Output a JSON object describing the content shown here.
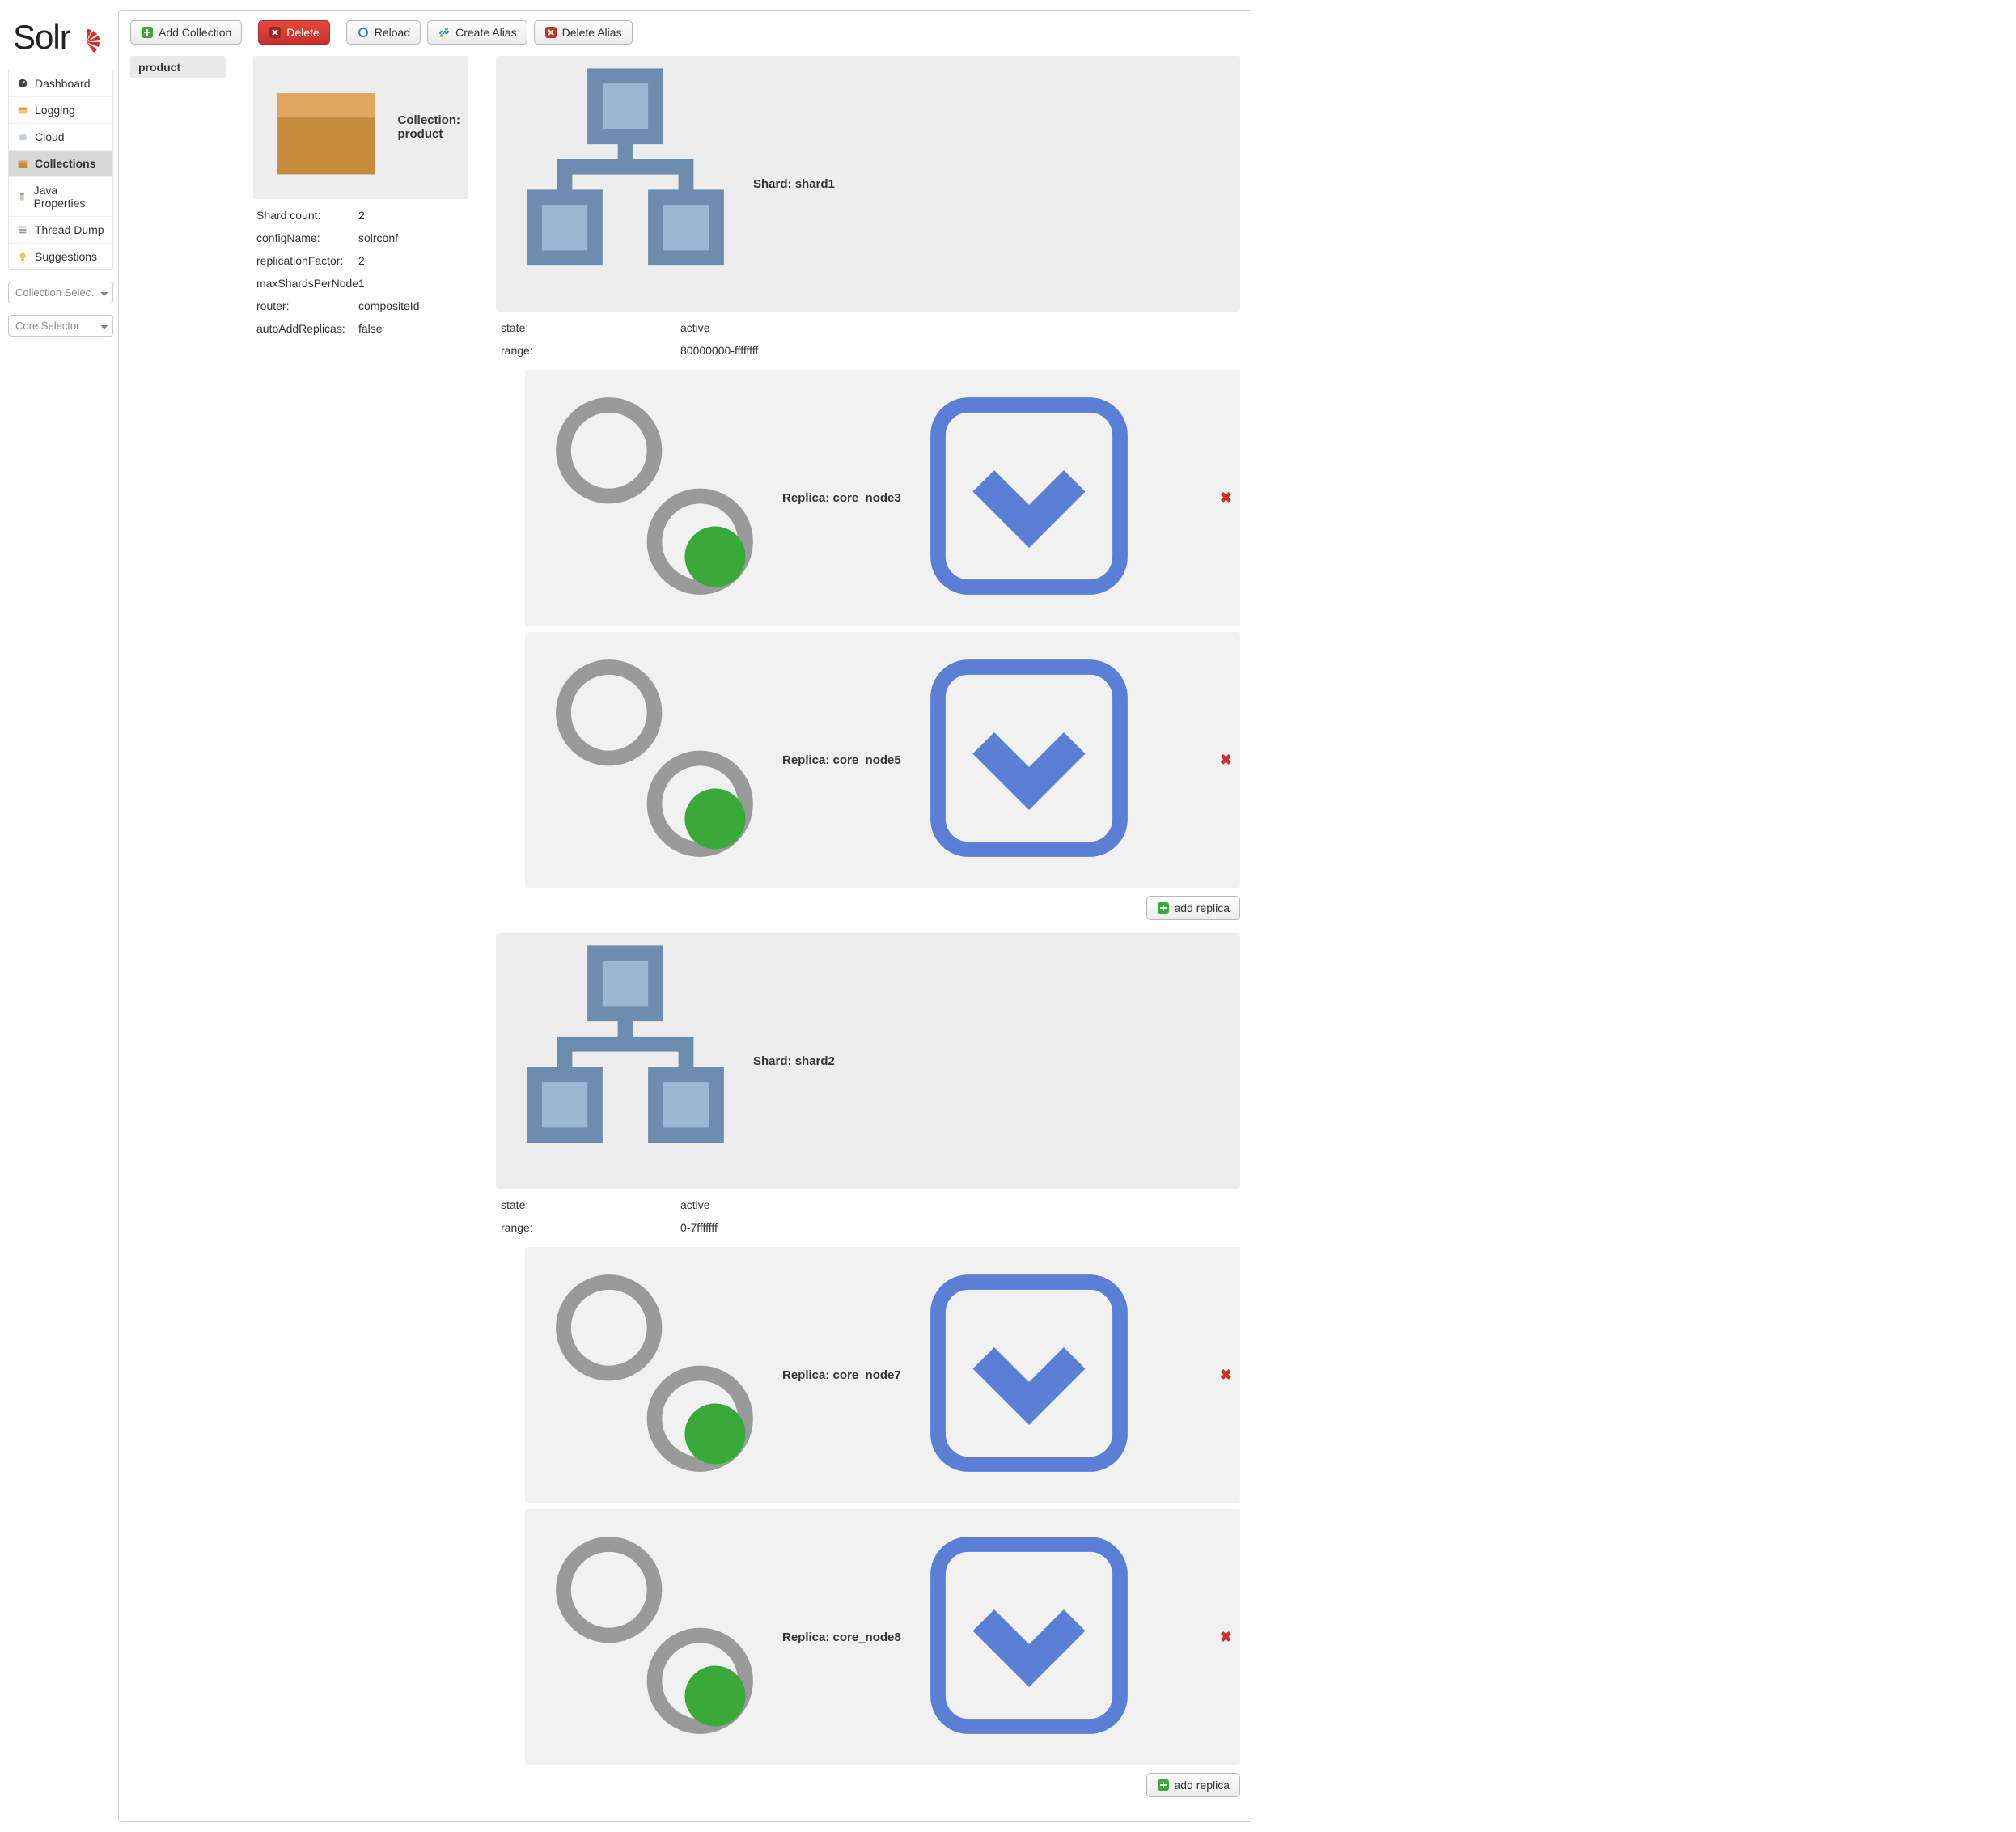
{
  "logo": {
    "text": "Solr"
  },
  "sidebar": {
    "items": [
      {
        "label": "Dashboard",
        "name": "dashboard",
        "icon": "gauge"
      },
      {
        "label": "Logging",
        "name": "logging",
        "icon": "inbox"
      },
      {
        "label": "Cloud",
        "name": "cloud",
        "icon": "cloud"
      },
      {
        "label": "Collections",
        "name": "collections",
        "icon": "box",
        "active": true
      },
      {
        "label": "Java Properties",
        "name": "java-properties",
        "icon": "jar"
      },
      {
        "label": "Thread Dump",
        "name": "thread-dump",
        "icon": "stack"
      },
      {
        "label": "Suggestions",
        "name": "suggestions",
        "icon": "bulb"
      }
    ],
    "collection_selector_placeholder": "Collection Selec…",
    "core_selector_placeholder": "Core Selector"
  },
  "toolbar": {
    "add_collection": "Add Collection",
    "delete": "Delete",
    "reload": "Reload",
    "create_alias": "Create Alias",
    "delete_alias": "Delete Alias"
  },
  "collections_list": [
    "product"
  ],
  "collection": {
    "heading_prefix": "Collection: ",
    "name": "product",
    "props": [
      {
        "k": "Shard count:",
        "v": "2"
      },
      {
        "k": "configName:",
        "v": "solrconf"
      },
      {
        "k": "replicationFactor:",
        "v": "2"
      },
      {
        "k": "maxShardsPerNode:",
        "v": "1"
      },
      {
        "k": "router:",
        "v": "compositeId"
      },
      {
        "k": "autoAddReplicas:",
        "v": "false"
      }
    ]
  },
  "shards": [
    {
      "heading_prefix": "Shard: ",
      "name": "shard1",
      "state_label": "state:",
      "state": "active",
      "range_label": "range:",
      "range": "80000000-ffffffff",
      "replicas": [
        {
          "label_prefix": "Replica: ",
          "name": "core_node3"
        },
        {
          "label_prefix": "Replica: ",
          "name": "core_node5"
        }
      ],
      "add_replica_label": "add replica"
    },
    {
      "heading_prefix": "Shard: ",
      "name": "shard2",
      "state_label": "state:",
      "state": "active",
      "range_label": "range:",
      "range": "0-7fffffff",
      "replicas": [
        {
          "label_prefix": "Replica: ",
          "name": "core_node7"
        },
        {
          "label_prefix": "Replica: ",
          "name": "core_node8"
        }
      ],
      "add_replica_label": "add replica"
    }
  ]
}
